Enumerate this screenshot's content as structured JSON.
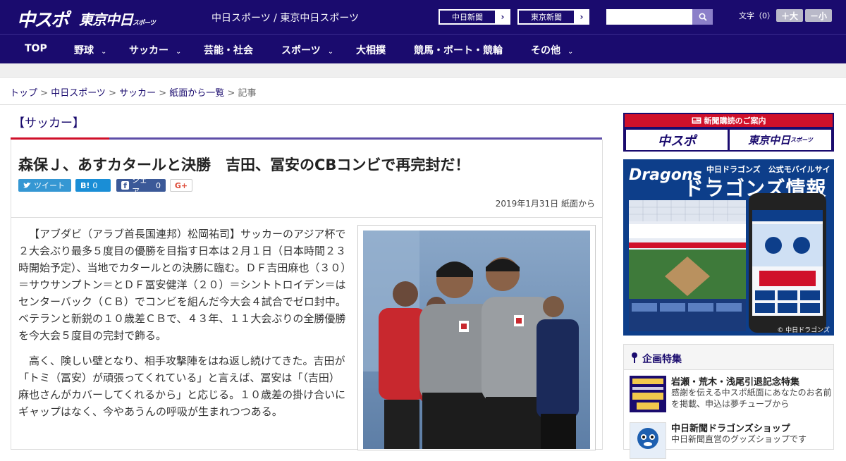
{
  "header": {
    "logo_chuspo": "中スポ",
    "logo_tokyo": "東京中日",
    "logo_tokyo_small": "スポーツ",
    "site_name": "中日スポーツ / 東京中日スポーツ",
    "btn_chunichi": "中日新聞",
    "btn_tokyo": "東京新聞",
    "arrow": "›",
    "search_placeholder": "",
    "font_label": "文字（0）",
    "font_larger": "＋大",
    "font_smaller": "－小"
  },
  "nav": {
    "items": [
      {
        "label": "TOP"
      },
      {
        "label": "野球"
      },
      {
        "label": "サッカー"
      },
      {
        "label": "芸能・社会"
      },
      {
        "label": "スポーツ"
      },
      {
        "label": "大相撲"
      },
      {
        "label": "競馬・ボート・競輪"
      },
      {
        "label": "その他"
      }
    ],
    "chevron": "⌄"
  },
  "breadcrumb": {
    "items": [
      "トップ",
      "中日スポーツ",
      "サッカー",
      "紙面から一覧"
    ],
    "separator": " > ",
    "current": "記事"
  },
  "article": {
    "category": "【サッカー】",
    "title": "森保Ｊ、あすカタールと決勝　吉田、冨安のCBコンビで再完封だ！",
    "share": {
      "tweet": "ツイート",
      "hatena_icon": "B!",
      "hatena_count": "0",
      "fb_label": "シェア",
      "fb_count": "0",
      "gplus": "G+"
    },
    "date": "2019年1月31日 紙面から",
    "paragraphs": [
      "【アブダビ（アラブ首長国連邦）松岡祐司】サッカーのアジア杯で２大会ぶり最多５度目の優勝を目指す日本は２月１日（日本時間２３時開始予定）、当地でカタールとの決勝に臨む。ＤＦ吉田麻也（３０）＝サウサンプトン＝とＤＦ冨安健洋（２０）＝シントトロイデン＝はセンターバック（ＣＢ）でコンビを組んだ今大会４試合でゼロ封中。ベテランと新鋭の１０歳差ＣＢで、４３年、１１大会ぶりの全勝優勝を今大会５度目の完封で飾る。",
      "高く、険しい壁となり、相手攻撃陣をはね返し続けてきた。吉田が「トミ（冨安）が頑張ってくれている」と言えば、冨安は「（吉田）麻也さんがカバーしてくれるから」と応じる。１０歳差の掛け合いにギャップはなく、今やあうんの呼吸が生まれつつある。"
    ]
  },
  "sidebar": {
    "subscribe_title": "新聞購読のご案内",
    "subscribe_chuspo": "中スポ",
    "subscribe_tokyo": "東京中日",
    "subscribe_tokyo_small": "スポーツ",
    "dragons_brand": "Dragons",
    "dragons_sub": "中日ドラゴンズ　公式モバイルサイト",
    "dragons_main": "ドラゴンズ情報",
    "dragons_copy": "© 中日ドラゴンズ",
    "feature_title": "企画特集",
    "features": [
      {
        "title": "岩瀬・荒木・浅尾引退記念特集",
        "desc": "感謝を伝える中スポ紙面にあなたのお名前を掲載、申込は夢チューブから"
      },
      {
        "title": "中日新聞ドラゴンズショップ",
        "desc": "中日新聞直営のグッズショップです"
      }
    ]
  },
  "colors": {
    "brand_navy": "#1a0b6e",
    "accent_red": "#d0102a",
    "accent_purple": "#5e4ea8"
  }
}
